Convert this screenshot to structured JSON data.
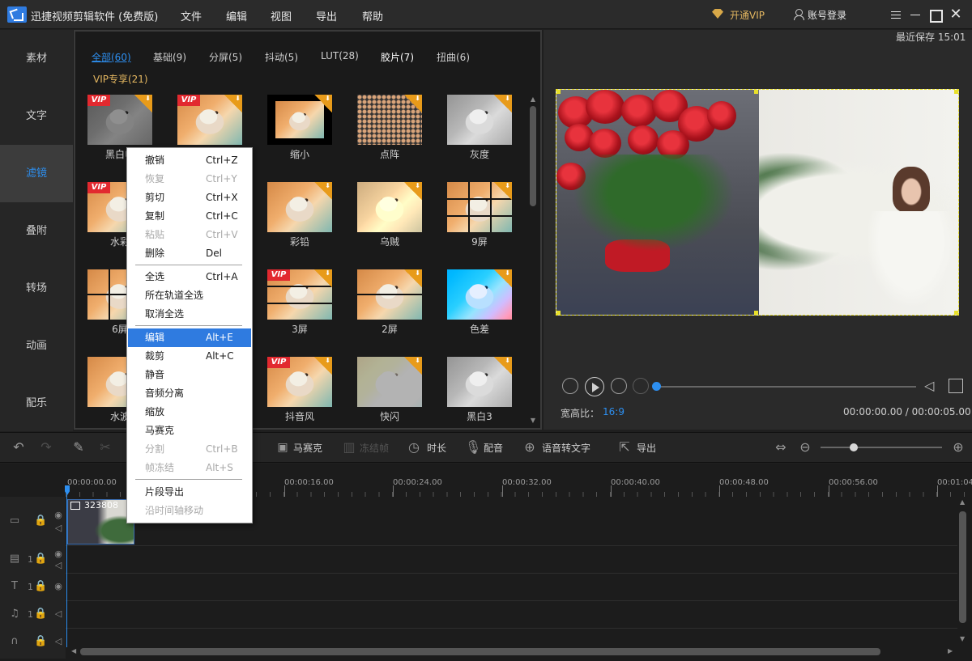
{
  "app": {
    "title": "迅捷视频剪辑软件 (免费版)",
    "menu": [
      "文件",
      "编辑",
      "视图",
      "导出",
      "帮助"
    ],
    "vip_label": "开通VIP",
    "login_label": "账号登录"
  },
  "sidebar": {
    "items": [
      {
        "label": "素材"
      },
      {
        "label": "文字"
      },
      {
        "label": "滤镜"
      },
      {
        "label": "叠附"
      },
      {
        "label": "转场"
      },
      {
        "label": "动画"
      },
      {
        "label": "配乐"
      }
    ],
    "active_index": 2
  },
  "filters": {
    "tabs": [
      "全部(60)",
      "基础(9)",
      "分屏(5)",
      "抖动(5)",
      "LUT(28)",
      "胶片(7)",
      "扭曲(6)"
    ],
    "vip_tab": "VIP专享(21)",
    "items": [
      {
        "label": "黑白电",
        "vip": true
      },
      {
        "label": "",
        "vip": true
      },
      {
        "label": "缩小",
        "vip": false
      },
      {
        "label": "点阵",
        "vip": false
      },
      {
        "label": "灰度",
        "vip": false
      },
      {
        "label": "水彩",
        "vip": true
      },
      {
        "label": "",
        "vip": false
      },
      {
        "label": "彩铅",
        "vip": false
      },
      {
        "label": "乌贼",
        "vip": false
      },
      {
        "label": "9屏",
        "vip": false
      },
      {
        "label": "6屏",
        "vip": false
      },
      {
        "label": "",
        "vip": false
      },
      {
        "label": "3屏",
        "vip": true
      },
      {
        "label": "2屏",
        "vip": false
      },
      {
        "label": "色差",
        "vip": false
      },
      {
        "label": "水波",
        "vip": false
      },
      {
        "label": "",
        "vip": false
      },
      {
        "label": "抖音风",
        "vip": true
      },
      {
        "label": "快闪",
        "vip": false
      },
      {
        "label": "黑白3",
        "vip": false
      }
    ],
    "vip_badge": "VIP"
  },
  "context_menu": {
    "items": [
      {
        "label": "撤销",
        "shortcut": "Ctrl+Z",
        "disabled": false
      },
      {
        "label": "恢复",
        "shortcut": "Ctrl+Y",
        "disabled": true
      },
      {
        "label": "剪切",
        "shortcut": "Ctrl+X",
        "disabled": false
      },
      {
        "label": "复制",
        "shortcut": "Ctrl+C",
        "disabled": false
      },
      {
        "label": "粘贴",
        "shortcut": "Ctrl+V",
        "disabled": true
      },
      {
        "label": "删除",
        "shortcut": "Del",
        "disabled": false
      },
      {
        "label": "全选",
        "shortcut": "Ctrl+A",
        "disabled": false
      },
      {
        "label": "所在轨道全选",
        "shortcut": "",
        "disabled": false
      },
      {
        "label": "取消全选",
        "shortcut": "",
        "disabled": false
      },
      {
        "label": "编辑",
        "shortcut": "Alt+E",
        "disabled": false,
        "highlighted": true
      },
      {
        "label": "裁剪",
        "shortcut": "Alt+C",
        "disabled": false
      },
      {
        "label": "静音",
        "shortcut": "",
        "disabled": false
      },
      {
        "label": "音频分离",
        "shortcut": "",
        "disabled": false
      },
      {
        "label": "缩放",
        "shortcut": "",
        "disabled": false
      },
      {
        "label": "马赛克",
        "shortcut": "",
        "disabled": false
      },
      {
        "label": "分割",
        "shortcut": "Ctrl+B",
        "disabled": true
      },
      {
        "label": "帧冻结",
        "shortcut": "Alt+S",
        "disabled": true
      },
      {
        "label": "片段导出",
        "shortcut": "",
        "disabled": false
      },
      {
        "label": "沿时间轴移动",
        "shortcut": "",
        "disabled": true
      }
    ]
  },
  "preview": {
    "last_saved": "最近保存 15:01",
    "aspect_label": "宽高比：",
    "aspect_value": "16:9",
    "timecode": "00:00:00.00 / 00:00:05.00",
    "progress": 0
  },
  "toolbar": {
    "items": [
      {
        "label": "马赛克",
        "disabled": false
      },
      {
        "label": "冻结帧",
        "disabled": true
      },
      {
        "label": "时长",
        "disabled": false
      },
      {
        "label": "配音",
        "disabled": false
      },
      {
        "label": "语音转文字",
        "disabled": false
      },
      {
        "label": "导出",
        "disabled": false
      }
    ],
    "zoom_level": 0.27
  },
  "timeline": {
    "ticks": [
      "00:00:00.00",
      "00:00:16.00",
      "00:00:24.00",
      "00:00:32.00",
      "00:00:40.00",
      "00:00:48.00",
      "00:00:56.00",
      "00:01:04"
    ],
    "clip_label": "323808",
    "track_numbers": [
      "1",
      "1",
      "1"
    ]
  }
}
